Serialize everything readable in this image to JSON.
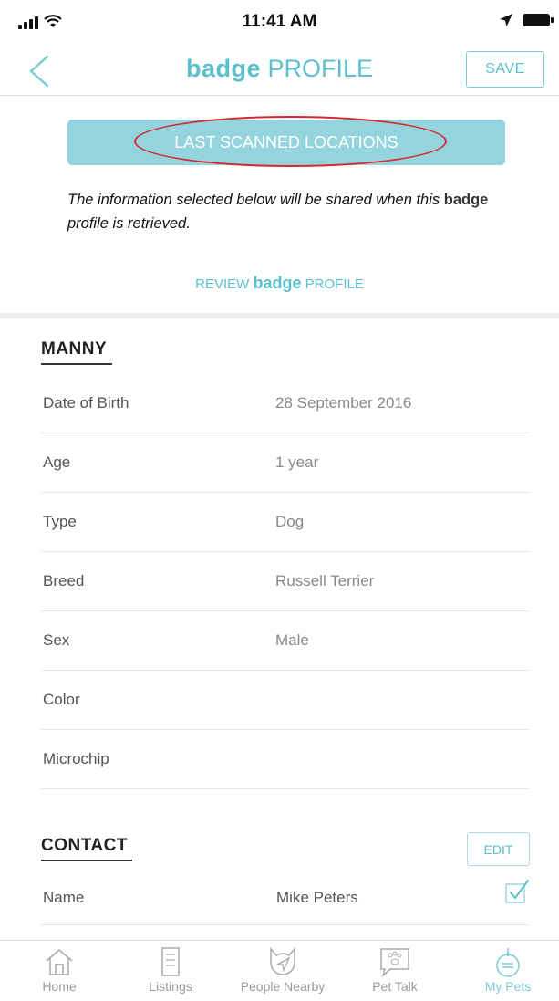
{
  "status_bar": {
    "time": "11:41 AM"
  },
  "header": {
    "title_brand": "badge",
    "title_rest": "PROFILE",
    "save_label": "SAVE"
  },
  "last_scanned_label": "LAST SCANNED LOCATIONS",
  "info": {
    "text_part1": "The information selected below will be shared when this",
    "brand": "badge",
    "text_part2": "profile is retrieved."
  },
  "review": {
    "prefix": "REVIEW",
    "brand": "badge",
    "suffix": "PROFILE"
  },
  "pet": {
    "section_title": "MANNY",
    "fields": [
      {
        "label": "Date of Birth",
        "value": "28 September 2016"
      },
      {
        "label": "Age",
        "value": "1 year"
      },
      {
        "label": "Type",
        "value": "Dog"
      },
      {
        "label": "Breed",
        "value": "Russell Terrier"
      },
      {
        "label": "Sex",
        "value": "Male"
      },
      {
        "label": "Color",
        "value": ""
      },
      {
        "label": "Microchip",
        "value": ""
      }
    ]
  },
  "contact": {
    "section_title": "CONTACT",
    "edit_label": "EDIT",
    "name_label": "Name",
    "name_value": "Mike Peters",
    "name_checked": true
  },
  "tabs": [
    {
      "label": "Home",
      "icon": "home-icon"
    },
    {
      "label": "Listings",
      "icon": "listings-icon"
    },
    {
      "label": "People Nearby",
      "icon": "people-nearby-icon"
    },
    {
      "label": "Pet Talk",
      "icon": "pet-talk-icon"
    },
    {
      "label": "My Pets",
      "icon": "my-pets-icon",
      "active": true
    }
  ],
  "colors": {
    "accent": "#5bbfcc",
    "button_fill": "#93d4df",
    "annotation": "#d8282d"
  }
}
